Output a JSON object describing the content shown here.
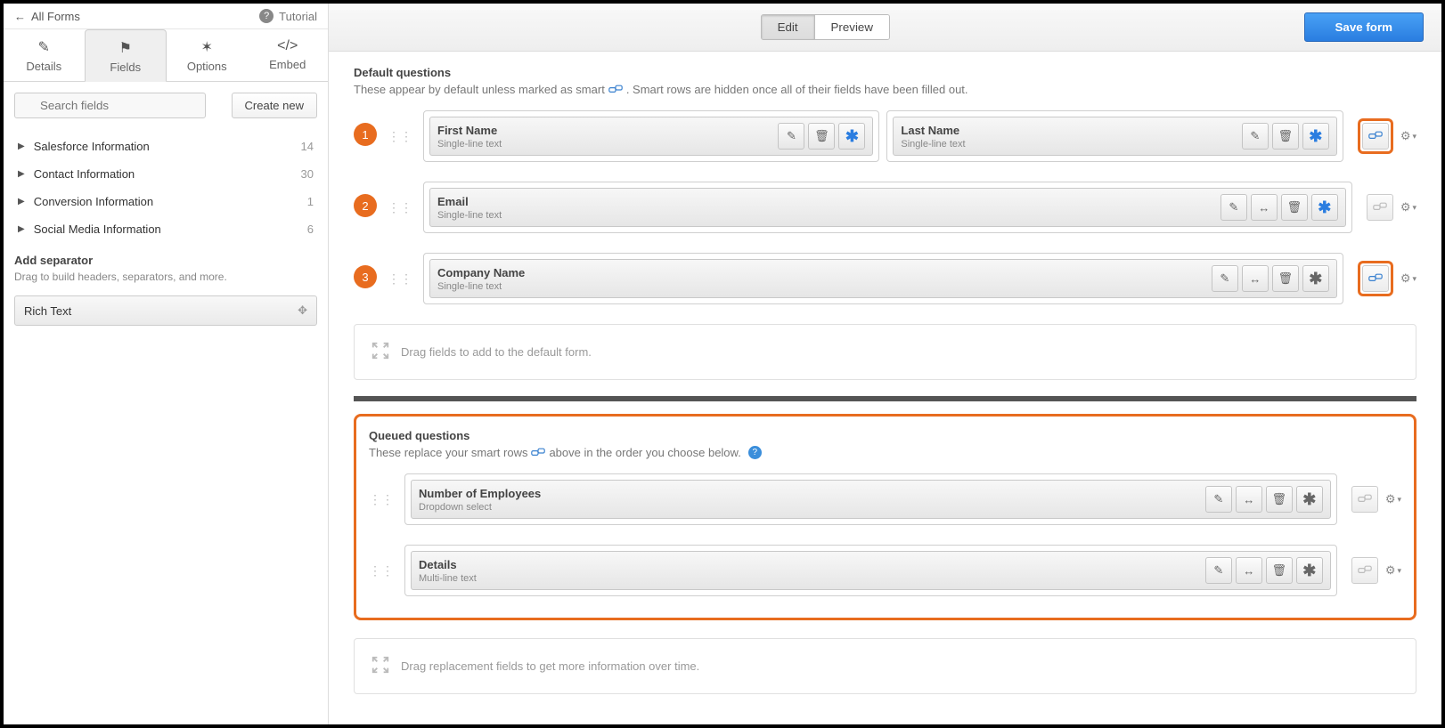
{
  "header": {
    "back_label": "All Forms",
    "tutorial_label": "Tutorial"
  },
  "tabs": [
    {
      "label": "Details"
    },
    {
      "label": "Fields"
    },
    {
      "label": "Options"
    },
    {
      "label": "Embed"
    }
  ],
  "search_placeholder": "Search fields",
  "create_button": "Create new",
  "categories": [
    {
      "label": "Salesforce Information",
      "count": "14"
    },
    {
      "label": "Contact Information",
      "count": "30"
    },
    {
      "label": "Conversion Information",
      "count": "1"
    },
    {
      "label": "Social Media Information",
      "count": "6"
    }
  ],
  "separator": {
    "title": "Add separator",
    "subtitle": "Drag to build headers, separators, and more.",
    "item": "Rich Text"
  },
  "toolbar": {
    "edit": "Edit",
    "preview": "Preview",
    "save": "Save form"
  },
  "default_section": {
    "title": "Default questions",
    "subtitle_a": "These appear by default unless marked as smart",
    "subtitle_b": ". Smart rows are hidden once all of their fields have been filled out."
  },
  "callouts": [
    "1",
    "2",
    "3"
  ],
  "fields": {
    "first": {
      "name": "First Name",
      "type": "Single-line text"
    },
    "last": {
      "name": "Last Name",
      "type": "Single-line text"
    },
    "email": {
      "name": "Email",
      "type": "Single-line text"
    },
    "company": {
      "name": "Company Name",
      "type": "Single-line text"
    },
    "employees": {
      "name": "Number of Employees",
      "type": "Dropdown select"
    },
    "details": {
      "name": "Details",
      "type": "Multi-line text"
    }
  },
  "dropzones": {
    "default": "Drag fields to add to the default form.",
    "queued": "Drag replacement fields to get more information over time."
  },
  "queued": {
    "title": "Queued questions",
    "subtitle_a": "These replace your smart rows",
    "subtitle_b": "above in the order you choose below."
  }
}
